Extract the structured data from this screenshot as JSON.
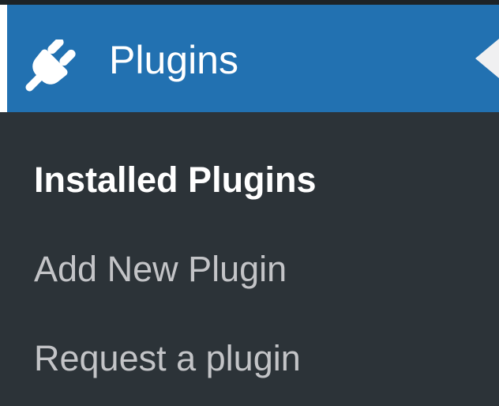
{
  "menu": {
    "icon": "plug-icon",
    "title": "Plugins",
    "submenu": [
      {
        "label": "Installed Plugins",
        "current": true
      },
      {
        "label": "Add New Plugin",
        "current": false
      },
      {
        "label": "Request a plugin",
        "current": false
      }
    ]
  },
  "colors": {
    "header_bg": "#2271b1",
    "menu_bg": "#2c3338",
    "top_strip": "#1d2327",
    "text_active": "#ffffff",
    "text_inactive": "#c3c4c7"
  }
}
